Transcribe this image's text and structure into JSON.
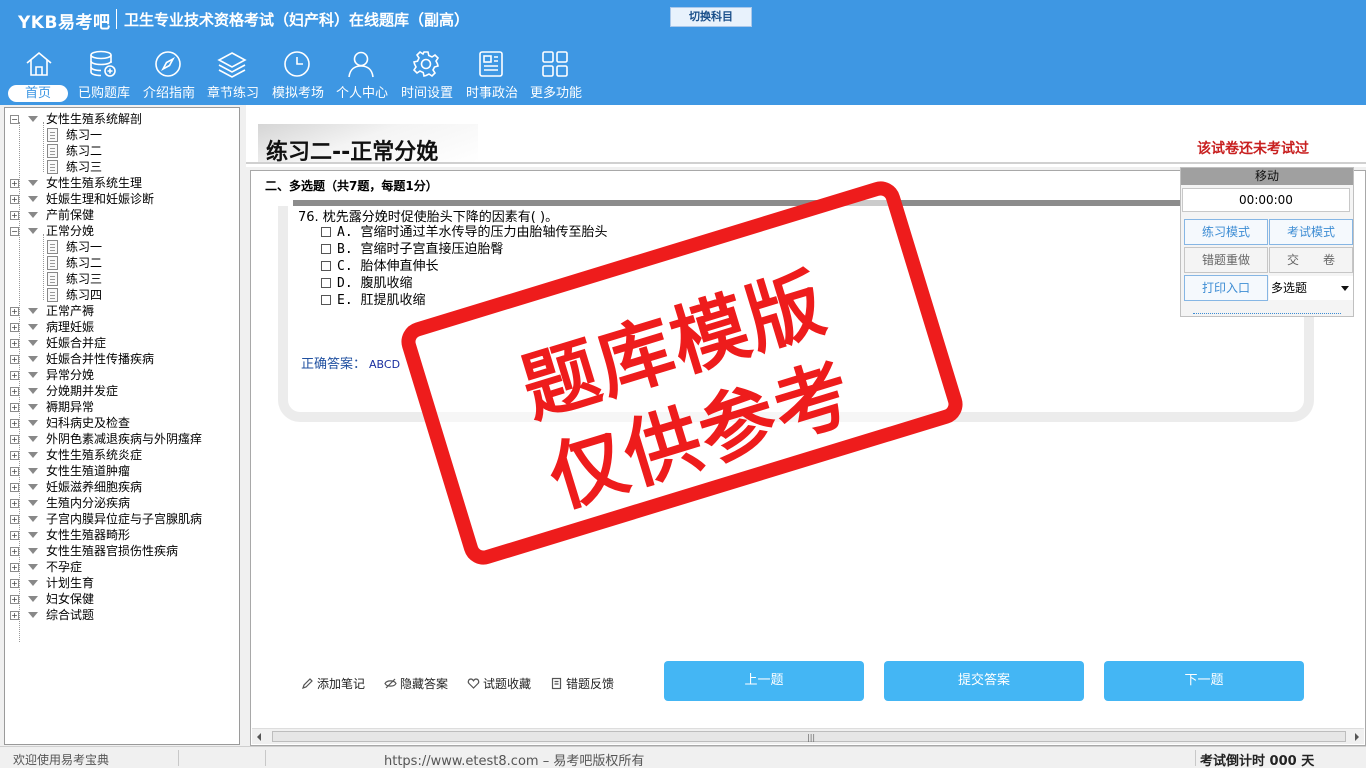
{
  "header": {
    "logo": "YKB易考吧",
    "app_title": "卫生专业技术资格考试（妇产科）在线题库（副高）",
    "switch_label": "切换科目"
  },
  "nav": [
    {
      "label": "首页",
      "icon": "home-icon"
    },
    {
      "label": "已购题库",
      "icon": "database-icon"
    },
    {
      "label": "介绍指南",
      "icon": "compass-icon"
    },
    {
      "label": "章节练习",
      "icon": "layers-icon"
    },
    {
      "label": "模拟考场",
      "icon": "clock-icon"
    },
    {
      "label": "个人中心",
      "icon": "user-icon"
    },
    {
      "label": "时间设置",
      "icon": "gear-icon"
    },
    {
      "label": "时事政治",
      "icon": "newspaper-icon"
    },
    {
      "label": "更多功能",
      "icon": "grid-icon"
    }
  ],
  "tree": {
    "items": [
      {
        "label": "女性生殖系统解剖",
        "kind": "folder",
        "expanded": true
      },
      {
        "label": "练习一",
        "kind": "doc"
      },
      {
        "label": "练习二",
        "kind": "doc"
      },
      {
        "label": "练习三",
        "kind": "doc"
      },
      {
        "label": "女性生殖系统生理",
        "kind": "folder"
      },
      {
        "label": "妊娠生理和妊娠诊断",
        "kind": "folder"
      },
      {
        "label": "产前保健",
        "kind": "folder"
      },
      {
        "label": "正常分娩",
        "kind": "folder",
        "expanded": true
      },
      {
        "label": "练习一",
        "kind": "doc"
      },
      {
        "label": "练习二",
        "kind": "doc"
      },
      {
        "label": "练习三",
        "kind": "doc"
      },
      {
        "label": "练习四",
        "kind": "doc"
      },
      {
        "label": "正常产褥",
        "kind": "folder"
      },
      {
        "label": "病理妊娠",
        "kind": "folder"
      },
      {
        "label": "妊娠合并症",
        "kind": "folder"
      },
      {
        "label": "妊娠合并性传播疾病",
        "kind": "folder"
      },
      {
        "label": "异常分娩",
        "kind": "folder"
      },
      {
        "label": "分娩期并发症",
        "kind": "folder"
      },
      {
        "label": "褥期异常",
        "kind": "folder"
      },
      {
        "label": "妇科病史及检查",
        "kind": "folder"
      },
      {
        "label": "外阴色素减退疾病与外阴瘙痒",
        "kind": "folder"
      },
      {
        "label": "女性生殖系统炎症",
        "kind": "folder"
      },
      {
        "label": "女性生殖道肿瘤",
        "kind": "folder"
      },
      {
        "label": "妊娠滋养细胞疾病",
        "kind": "folder"
      },
      {
        "label": "生殖内分泌疾病",
        "kind": "folder"
      },
      {
        "label": "子宫内膜异位症与子宫腺肌病",
        "kind": "folder"
      },
      {
        "label": "女性生殖器畸形",
        "kind": "folder"
      },
      {
        "label": "女性生殖器官损伤性疾病",
        "kind": "folder"
      },
      {
        "label": "不孕症",
        "kind": "folder"
      },
      {
        "label": "计划生育",
        "kind": "folder"
      },
      {
        "label": "妇女保健",
        "kind": "folder"
      },
      {
        "label": "综合试题",
        "kind": "folder"
      }
    ]
  },
  "main": {
    "title": "练习二--正常分娩",
    "status": "该试卷还未考试过",
    "section": "二、多选题（共7题，每题1分）",
    "question": "76. 枕先露分娩时促使胎头下降的因素有( )。",
    "options": [
      "A. 宫缩时通过羊水传导的压力由胎轴传至胎头",
      "B. 宫缩时子宫直接压迫胎臀",
      "C. 胎体伸直伸长",
      "D. 腹肌收缩",
      "E. 肛提肌收缩"
    ],
    "answer_label": "正确答案：",
    "answer_value": "ABCD"
  },
  "panel": {
    "move": "移动",
    "timer": "00:00:00",
    "practice_mode": "练习模式",
    "exam_mode": "考试模式",
    "redo_wrong": "错题重做",
    "submit_paper": "交　　卷",
    "print": "打印入口",
    "type_select": "多选题"
  },
  "tools": {
    "note": "添加笔记",
    "hide": "隐藏答案",
    "fav": "试题收藏",
    "feedback": "错题反馈"
  },
  "buttons": {
    "prev": "上一题",
    "submit": "提交答案",
    "next": "下一题"
  },
  "status": {
    "welcome": "欢迎使用易考宝典",
    "url": "https://www.etest8.com – 易考吧版权所有",
    "countdown": "考试倒计时 000 天"
  },
  "stamp": {
    "line1": "题库模版",
    "line2": "仅供参考",
    "color": "#ee1c1c"
  },
  "colors": {
    "header": "#3e97e3",
    "primary_button": "#44b6f4",
    "alert": "#c82020"
  }
}
